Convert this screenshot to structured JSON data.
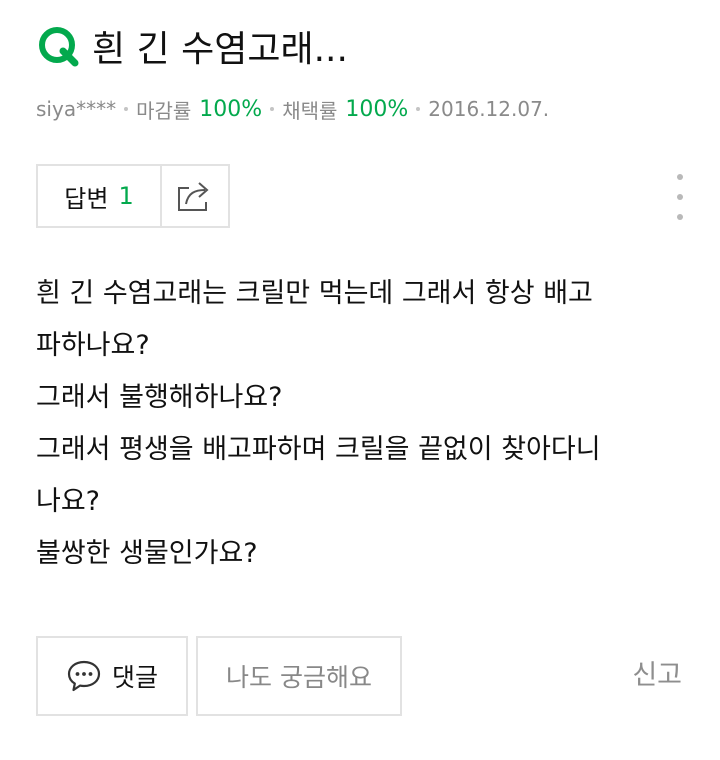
{
  "question": {
    "title": "흰 긴 수염고래...",
    "author": "siya****",
    "closing_rate_label": "마감률",
    "closing_rate_value": "100%",
    "adoption_rate_label": "채택률",
    "adoption_rate_value": "100%",
    "date": "2016.12.07.",
    "body_lines": [
      "흰 긴 수염고래는 크릴만 먹는데 그래서 항상 배고",
      "파하나요?",
      "그래서 불행해하나요?",
      "그래서 평생을 배고파하며 크릴을 끝없이 찾아다니",
      "나요?",
      "불쌍한 생물인가요?"
    ]
  },
  "actions": {
    "answer_label": "답변",
    "answer_count": "1",
    "comment_label": "댓글",
    "curious_label": "나도 궁금해요",
    "report_label": "신고"
  },
  "icons": {
    "question": "q-icon",
    "share": "share-icon",
    "more": "more-vertical-icon",
    "comment": "speech-bubble-icon"
  },
  "colors": {
    "accent": "#03a94d",
    "muted_text": "#8a8a8a",
    "border": "#e2e2e2"
  }
}
